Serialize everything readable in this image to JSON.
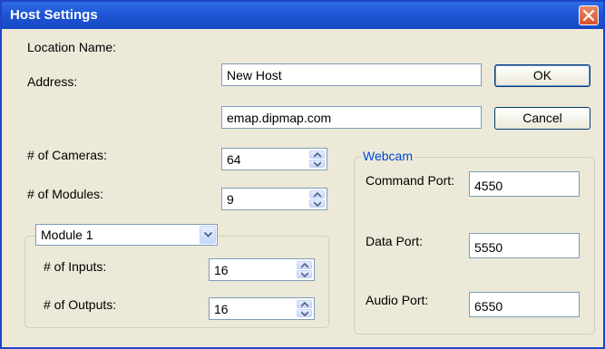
{
  "window": {
    "title": "Host Settings",
    "close_icon": "close-icon"
  },
  "form": {
    "location_name": {
      "label": "Location Name:",
      "value": "New Host"
    },
    "address": {
      "label": "Address:",
      "value": "emap.dipmap.com"
    },
    "cameras": {
      "label": "# of Cameras:",
      "value": "64"
    },
    "modules": {
      "label": "# of Modules:",
      "value": "9"
    }
  },
  "buttons": {
    "ok": "OK",
    "cancel": "Cancel"
  },
  "module_group": {
    "selected": "Module 1",
    "inputs": {
      "label": "# of Inputs:",
      "value": "16"
    },
    "outputs": {
      "label": "# of Outputs:",
      "value": "16"
    }
  },
  "webcam": {
    "legend": "Webcam",
    "command_port": {
      "label": "Command Port:",
      "value": "4550"
    },
    "data_port": {
      "label": "Data Port:",
      "value": "5550"
    },
    "audio_port": {
      "label": "Audio Port:",
      "value": "6550"
    }
  },
  "colors": {
    "title_bar": "#1f56d6",
    "dialog_bg": "#ece9d8",
    "legend": "#0046d5",
    "close_button": "#d9532b"
  }
}
